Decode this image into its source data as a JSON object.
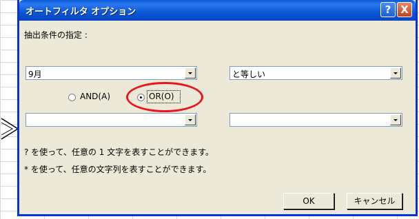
{
  "dialog": {
    "title": "オートフィルタ オプション",
    "help_button": "?",
    "close_button": "X",
    "section_label": "抽出条件の指定 :",
    "condition1": {
      "field_value": "9月",
      "operator_value": "と等しい"
    },
    "logic": {
      "and_label": "AND(A)",
      "or_label": "OR(O)",
      "selected": "OR"
    },
    "condition2": {
      "field_value": "",
      "operator_value": ""
    },
    "hint1": "? を使って、任意の 1 文字を表すことができます。",
    "hint2": "* を使って、任意の文字列を表すことができます。",
    "ok_label": "OK",
    "cancel_label": "キャンセル"
  },
  "colors": {
    "titlebar": "#0a5bd8",
    "dialog_bg": "#ece9d8",
    "highlight": "#e8161e"
  }
}
